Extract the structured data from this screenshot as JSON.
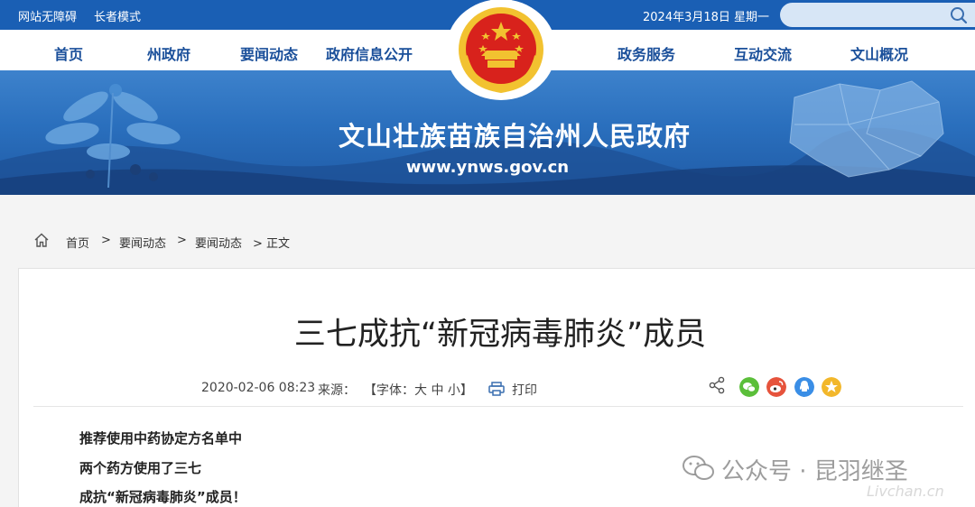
{
  "topbar": {
    "accessibility_link": "网站无障碍",
    "elder_mode_link": "长者模式",
    "date": "2024年3月18日 星期一",
    "search_placeholder": ""
  },
  "nav": {
    "items": [
      "首页",
      "州政府",
      "要闻动态",
      "政府信息公开",
      "政务服务",
      "互动交流",
      "文山概况"
    ]
  },
  "banner": {
    "title": "文山壮族苗族自治州人民政府",
    "url": "www.ynws.gov.cn"
  },
  "breadcrumb": {
    "items": [
      "首页",
      ">",
      "要闻动态",
      ">",
      "要闻动态",
      "> 正文"
    ]
  },
  "article": {
    "title": "三七成抗“新冠病毒肺炎”成员",
    "datetime": "2020-02-06 08:23",
    "source_label": "来源：",
    "font_size_control": "【字体：大 中 小】",
    "print_label": "打印",
    "paragraphs": [
      "推荐使用中药协定方名单中",
      "两个药方使用了三七",
      "成抗“新冠病毒肺炎”成员！"
    ]
  },
  "share": {
    "icons": [
      "share-icon",
      "wechat-icon",
      "weibo-icon",
      "qq-icon",
      "qzone-icon"
    ],
    "colors": {
      "wechat": "#5bbf3a",
      "weibo": "#e6533c",
      "qq": "#3a8ee6",
      "qzone": "#f2b72b"
    }
  },
  "watermark": {
    "text": "公众号 · 昆羽继圣",
    "url": "Livchan.cn"
  },
  "colors": {
    "brand_blue": "#1a5fb4",
    "nav_text": "#1a4f9a",
    "emblem_red": "#d8221c",
    "emblem_gold": "#f2c230"
  }
}
